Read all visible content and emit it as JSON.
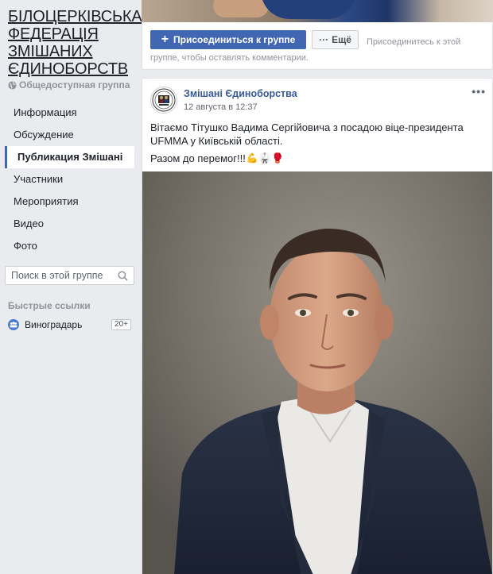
{
  "group": {
    "title": "БІЛОЦЕРКІВСЬКА ФЕДЕРАЦІЯ ЗМІШАНИХ ЄДИНОБОРСТВ",
    "privacy": "Общедоступная группа"
  },
  "sidebar": {
    "items": [
      {
        "label": "Информация"
      },
      {
        "label": "Обсуждение"
      },
      {
        "label": "Публикация Змішані",
        "active": true
      },
      {
        "label": "Участники"
      },
      {
        "label": "Мероприятия"
      },
      {
        "label": "Видео"
      },
      {
        "label": "Фото"
      }
    ],
    "search_placeholder": "Поиск в этой группе",
    "quick_links_title": "Быстрые ссылки",
    "quick_links": [
      {
        "label": "Виноградарь",
        "badge": "20+"
      }
    ]
  },
  "join_bar": {
    "join_label": "Присоединиться к группе",
    "more_label": "Ещё",
    "hint": "Присоединитесь к этой группе, чтобы оставлять комментарии."
  },
  "post": {
    "author": "Змішані Єдиноборства",
    "timestamp": "12 августа в 12:37",
    "menu": "•••",
    "text": "Вітаємо Тітушко Вадима Сергійовича з посадою віце-президента UFMMA у Київській області.",
    "text2": "Разом до перемог!!!",
    "emojis": [
      "💪",
      "🥋",
      "🥊"
    ]
  },
  "colors": {
    "brand": "#4267b2",
    "link": "#385898",
    "background": "#e9ebee"
  }
}
